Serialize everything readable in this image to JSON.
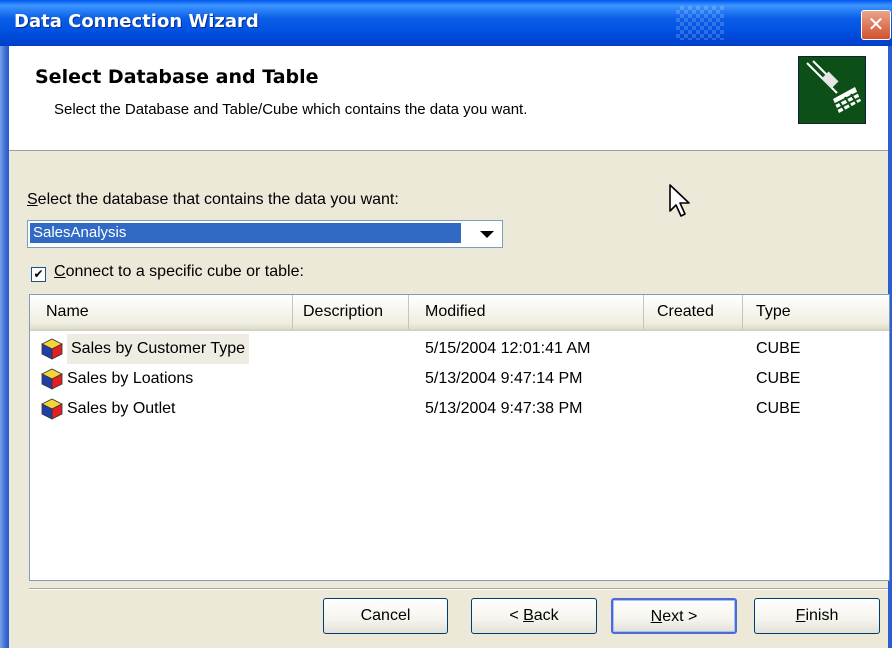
{
  "window": {
    "title": "Data Connection Wizard",
    "close_glyph": "✕"
  },
  "header": {
    "title": "Select Database and Table",
    "subtitle": "Select the Database and Table/Cube which contains the data you want.",
    "icon": "plug-and-table-icon"
  },
  "database": {
    "label_first": "S",
    "label_rest": "elect the database that contains the data you want:",
    "value": "SalesAnalysis"
  },
  "specific": {
    "checked": true,
    "check_glyph": "✔",
    "label_first": "C",
    "label_rest": "onnect to a specific cube or table:"
  },
  "table": {
    "columns": [
      "Name",
      "Description",
      "Modified",
      "Created",
      "Type"
    ],
    "rows": [
      {
        "name": "Sales by Customer Type",
        "description": "",
        "modified": "5/15/2004 12:01:41 AM",
        "created": "",
        "type": "CUBE",
        "selected": true
      },
      {
        "name": "Sales by Loations",
        "description": "",
        "modified": "5/13/2004 9:47:14 PM",
        "created": "",
        "type": "CUBE",
        "selected": false
      },
      {
        "name": "Sales by Outlet",
        "description": "",
        "modified": "5/13/2004 9:47:38 PM",
        "created": "",
        "type": "CUBE",
        "selected": false
      }
    ]
  },
  "buttons": {
    "cancel": "Cancel",
    "back_prefix": "< ",
    "back_first": "B",
    "back_rest": "ack",
    "next_first": "N",
    "next_rest": "ext >",
    "finish_first": "F",
    "finish_rest": "inish"
  },
  "colors": {
    "title_bar": "#0a5ee8",
    "selection": "#316ac5",
    "dialog_bg": "#ece9d8"
  }
}
